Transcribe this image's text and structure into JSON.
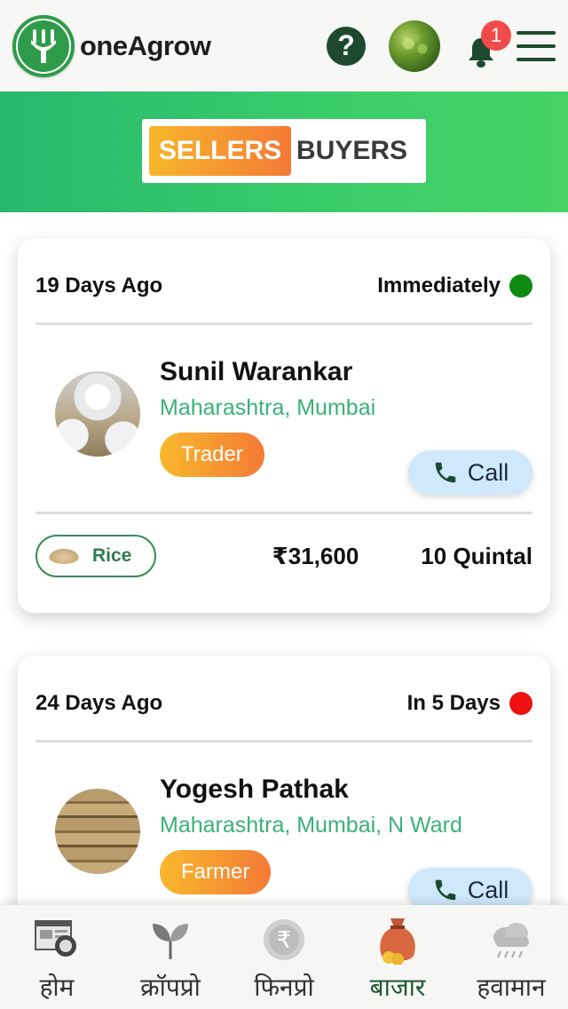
{
  "header": {
    "brand": "oneAgrow",
    "help_glyph": "?",
    "notification_count": "1",
    "icons": [
      "fork-logo-icon",
      "help-icon",
      "profile-avatar",
      "bell-icon",
      "menu-icon"
    ]
  },
  "toggle": {
    "sellers_label": "SELLERS",
    "buyers_label": "BUYERS",
    "active": "SELLERS"
  },
  "listings": [
    {
      "posted": "19 Days Ago",
      "availability": "Immediately",
      "availability_color": "#0c8a12",
      "name": "Sunil Warankar",
      "location": "Maharashtra, Mumbai",
      "role": "Trader",
      "call_label": "Call",
      "crop": "Rice",
      "price": "₹31,600",
      "quantity": "10 Quintal"
    },
    {
      "posted": "24 Days Ago",
      "availability": "In 5 Days",
      "availability_color": "#ee1111",
      "name": "Yogesh Pathak",
      "location": "Maharashtra, Mumbai, N Ward",
      "role": "Farmer",
      "call_label": "Call"
    }
  ],
  "bottom_nav": [
    {
      "label": "होम",
      "icon": "home-search-icon"
    },
    {
      "label": "क्रॉपप्रो",
      "icon": "sprout-icon"
    },
    {
      "label": "फिनप्रो",
      "icon": "rupee-coin-icon"
    },
    {
      "label": "बाजार",
      "icon": "money-bag-icon",
      "active": true
    },
    {
      "label": "हवामान",
      "icon": "rain-cloud-icon"
    }
  ],
  "colors": {
    "brand_green": "#2e9b4a",
    "dark_green": "#1d4a2f",
    "location_green": "#3bb07a",
    "orange_start": "#f6b62a",
    "orange_end": "#f47a36",
    "call_bg": "#cfe8fb",
    "badge_red": "#f14a4a"
  }
}
